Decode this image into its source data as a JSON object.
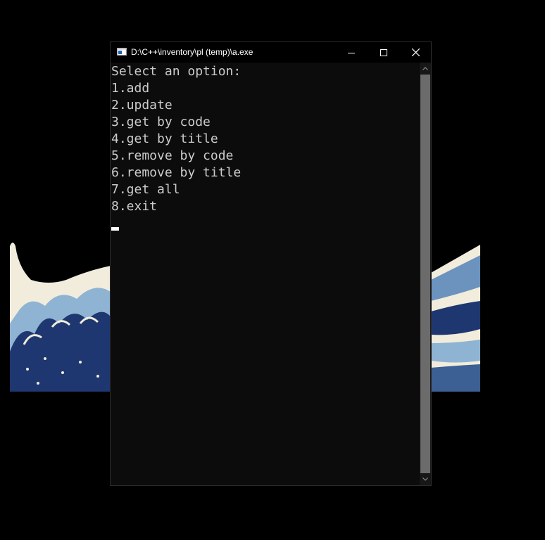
{
  "window": {
    "title": "D:\\C++\\inventory\\pl (temp)\\a.exe"
  },
  "console": {
    "lines": [
      "Select an option:",
      "1.add",
      "2.update",
      "3.get by code",
      "4.get by title",
      "5.remove by code",
      "6.remove by title",
      "7.get all",
      "8.exit"
    ]
  },
  "icons": {
    "app": "console-app-icon",
    "minimize": "minimize-icon",
    "maximize": "maximize-icon",
    "close": "close-icon",
    "scroll_up": "chevron-up-icon",
    "scroll_down": "chevron-down-icon"
  },
  "colors": {
    "desktop": "#000000",
    "console_bg": "#0c0c0c",
    "console_text": "#cccccc",
    "wave_dark": "#1f3770",
    "wave_light": "#7fa6c9",
    "foam": "#f1ecdc"
  }
}
